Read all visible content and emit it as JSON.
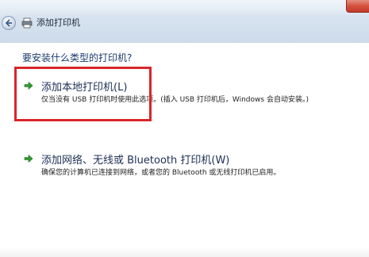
{
  "window": {
    "title": "添加打印机",
    "close_label": ""
  },
  "content": {
    "question": "要安装什么类型的打印机?",
    "options": [
      {
        "title": "添加本地打印机(L)",
        "description": "仅当没有 USB 打印机时使用此选项。(插入 USB 打印机后，Windows 会自动安装。)"
      },
      {
        "title": "添加网络、无线或 Bluetooth 打印机(W)",
        "description": "确保您的计算机已连接到网络，或者您的 Bluetooth 或无线打印机已启用。"
      }
    ]
  },
  "colors": {
    "highlight_border": "#d8262b",
    "arrow_green": "#2f9a2f",
    "title_blue": "#1c2f55"
  },
  "icons": {
    "back": "back-arrow-icon",
    "printer": "printer-icon",
    "option_arrow": "green-arrow-icon",
    "close": "close-icon"
  }
}
